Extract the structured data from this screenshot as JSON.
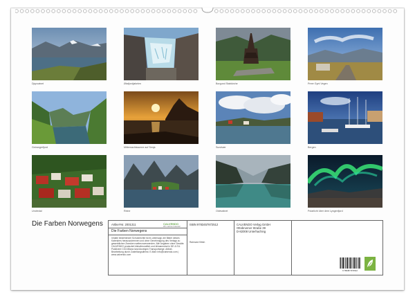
{
  "calendar": {
    "title": "Die Farben Norwegens",
    "photos": [
      {
        "caption": "Djupvatnet",
        "scene": "lake-mountains-snow"
      },
      {
        "caption": "Øksfjordjøkelen",
        "scene": "glacier-ice"
      },
      {
        "caption": "Borgund Stabkirche",
        "scene": "stave-church-valley"
      },
      {
        "caption": "Preer Gynt Vegen",
        "scene": "mountain-plateau-road"
      },
      {
        "caption": "Geirangerfjord",
        "scene": "fjord-green-mountains"
      },
      {
        "caption": "Mitternachtssonne auf Senja",
        "scene": "midnight-sun-sea"
      },
      {
        "caption": "Sundvær",
        "scene": "harbour-cloudy-sky"
      },
      {
        "caption": "Bergen",
        "scene": "harbour-boats-town"
      },
      {
        "caption": "Undredal",
        "scene": "village-red-houses"
      },
      {
        "caption": "Reine",
        "scene": "lofoten-village-peaks"
      },
      {
        "caption": "Oldevatnet",
        "scene": "turquoise-lake-mountains"
      },
      {
        "caption": "Polarlicht über dem Lyngenfjord",
        "scene": "aurora-green-night"
      }
    ]
  },
  "imprint": {
    "article_no": "Artikel-Nr. 2001311",
    "brand": "CALVENDO",
    "brand_sub": "Wir machen Kalender",
    "product_title": "Die Farben Norwegens",
    "legal_text": "Inhalte bestehender Schutzrechte ist es untersagt, die Bilder dieses Kalenders herauszutrennen und ohne Genehmigung des Verlags zu gewerblichen Zwecken weiterzuverwenden. Alle Angaben ohne Gewähr. CALVENDO produziert klimafreundlich und klimaneutral in DE & EU. Positivere CO2-Bilanz land Anzeigen Transportwege. Artikel-Bearbeitung durch Zustellungsdienst. E-Mail: info@calvendo.com | www.calvendo.com",
    "isbn": "ISBN 9783457872512",
    "author": "Raimund Kittch",
    "publisher_lines": [
      "CALVENDO Verlag GmbH",
      "Ottobrunner Straße 39",
      "D-82008 Unterhaching"
    ],
    "barcode_digits": "9 783457 872512"
  }
}
